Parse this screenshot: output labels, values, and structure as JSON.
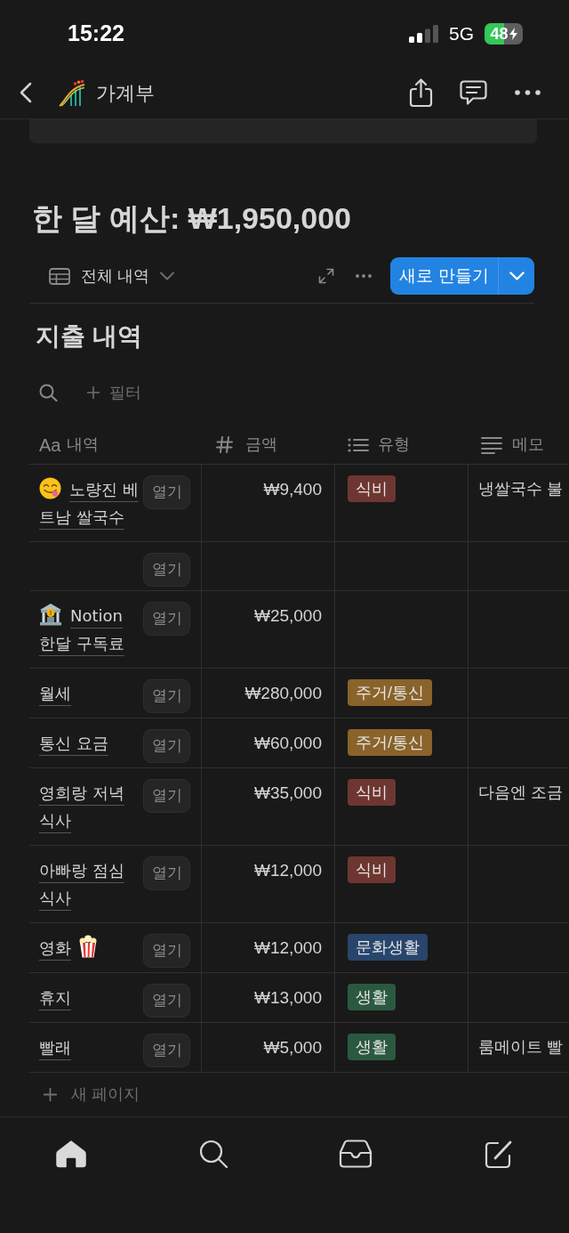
{
  "status_bar": {
    "time": "15:22",
    "network": "5G",
    "battery": "48"
  },
  "nav": {
    "title": "가계부"
  },
  "page": {
    "heading": "한 달 예산: ₩1,950,000"
  },
  "view_bar": {
    "view": "전체 내역",
    "new_button": "새로 만들기"
  },
  "database": {
    "title": "지출 내역",
    "filter": "필터",
    "columns": [
      {
        "kind": "title",
        "glyph": "Aa",
        "label": "내역"
      },
      {
        "kind": "number",
        "label": "금액"
      },
      {
        "kind": "select",
        "label": "유형"
      },
      {
        "kind": "text",
        "label": "메모"
      }
    ],
    "rows": [
      {
        "lead_icon": {
          "kind": "face"
        },
        "name": "노량진 베트남 쌀국수",
        "open_label": "열기",
        "amount": "₩9,400",
        "type": {
          "label": "식비",
          "color": "#6e3630"
        },
        "memo": "냉쌀국수 불"
      },
      {
        "open_label": "열기"
      },
      {
        "lead_icon": {
          "kind": "bank"
        },
        "name": "Notion 한달 구독료",
        "open_label": "열기",
        "amount": "₩25,000"
      },
      {
        "name": "월세",
        "open_label": "열기",
        "amount": "₩280,000",
        "type": {
          "label": "주거/통신",
          "color": "#89632a"
        }
      },
      {
        "name": "통신 요금",
        "open_label": "열기",
        "amount": "₩60,000",
        "type": {
          "label": "주거/통신",
          "color": "#89632a"
        }
      },
      {
        "name": "영희랑 저녁 식사",
        "open_label": "열기",
        "amount": "₩35,000",
        "type": {
          "label": "식비",
          "color": "#6e3630"
        },
        "memo": "다음엔 조금"
      },
      {
        "name": "아빠랑 점심 식사",
        "open_label": "열기",
        "amount": "₩12,000",
        "type": {
          "label": "식비",
          "color": "#6e3630"
        }
      },
      {
        "trail_icon": {
          "kind": "popcorn"
        },
        "name": "영화",
        "open_label": "열기",
        "amount": "₩12,000",
        "type": {
          "label": "문화생활",
          "color": "#28456c"
        }
      },
      {
        "name": "휴지",
        "open_label": "열기",
        "amount": "₩13,000",
        "type": {
          "label": "생활",
          "color": "#2b593f"
        }
      },
      {
        "name": "빨래",
        "open_label": "열기",
        "amount": "₩5,000",
        "type": {
          "label": "생활",
          "color": "#2b593f"
        },
        "memo": "룸메이트 빨"
      }
    ],
    "new_page": "새 페이지"
  },
  "tab_bar": [
    {
      "kind": "home",
      "selected": true
    },
    {
      "kind": "search",
      "selected": false
    },
    {
      "kind": "inbox",
      "selected": false
    },
    {
      "kind": "compose",
      "selected": false
    }
  ]
}
